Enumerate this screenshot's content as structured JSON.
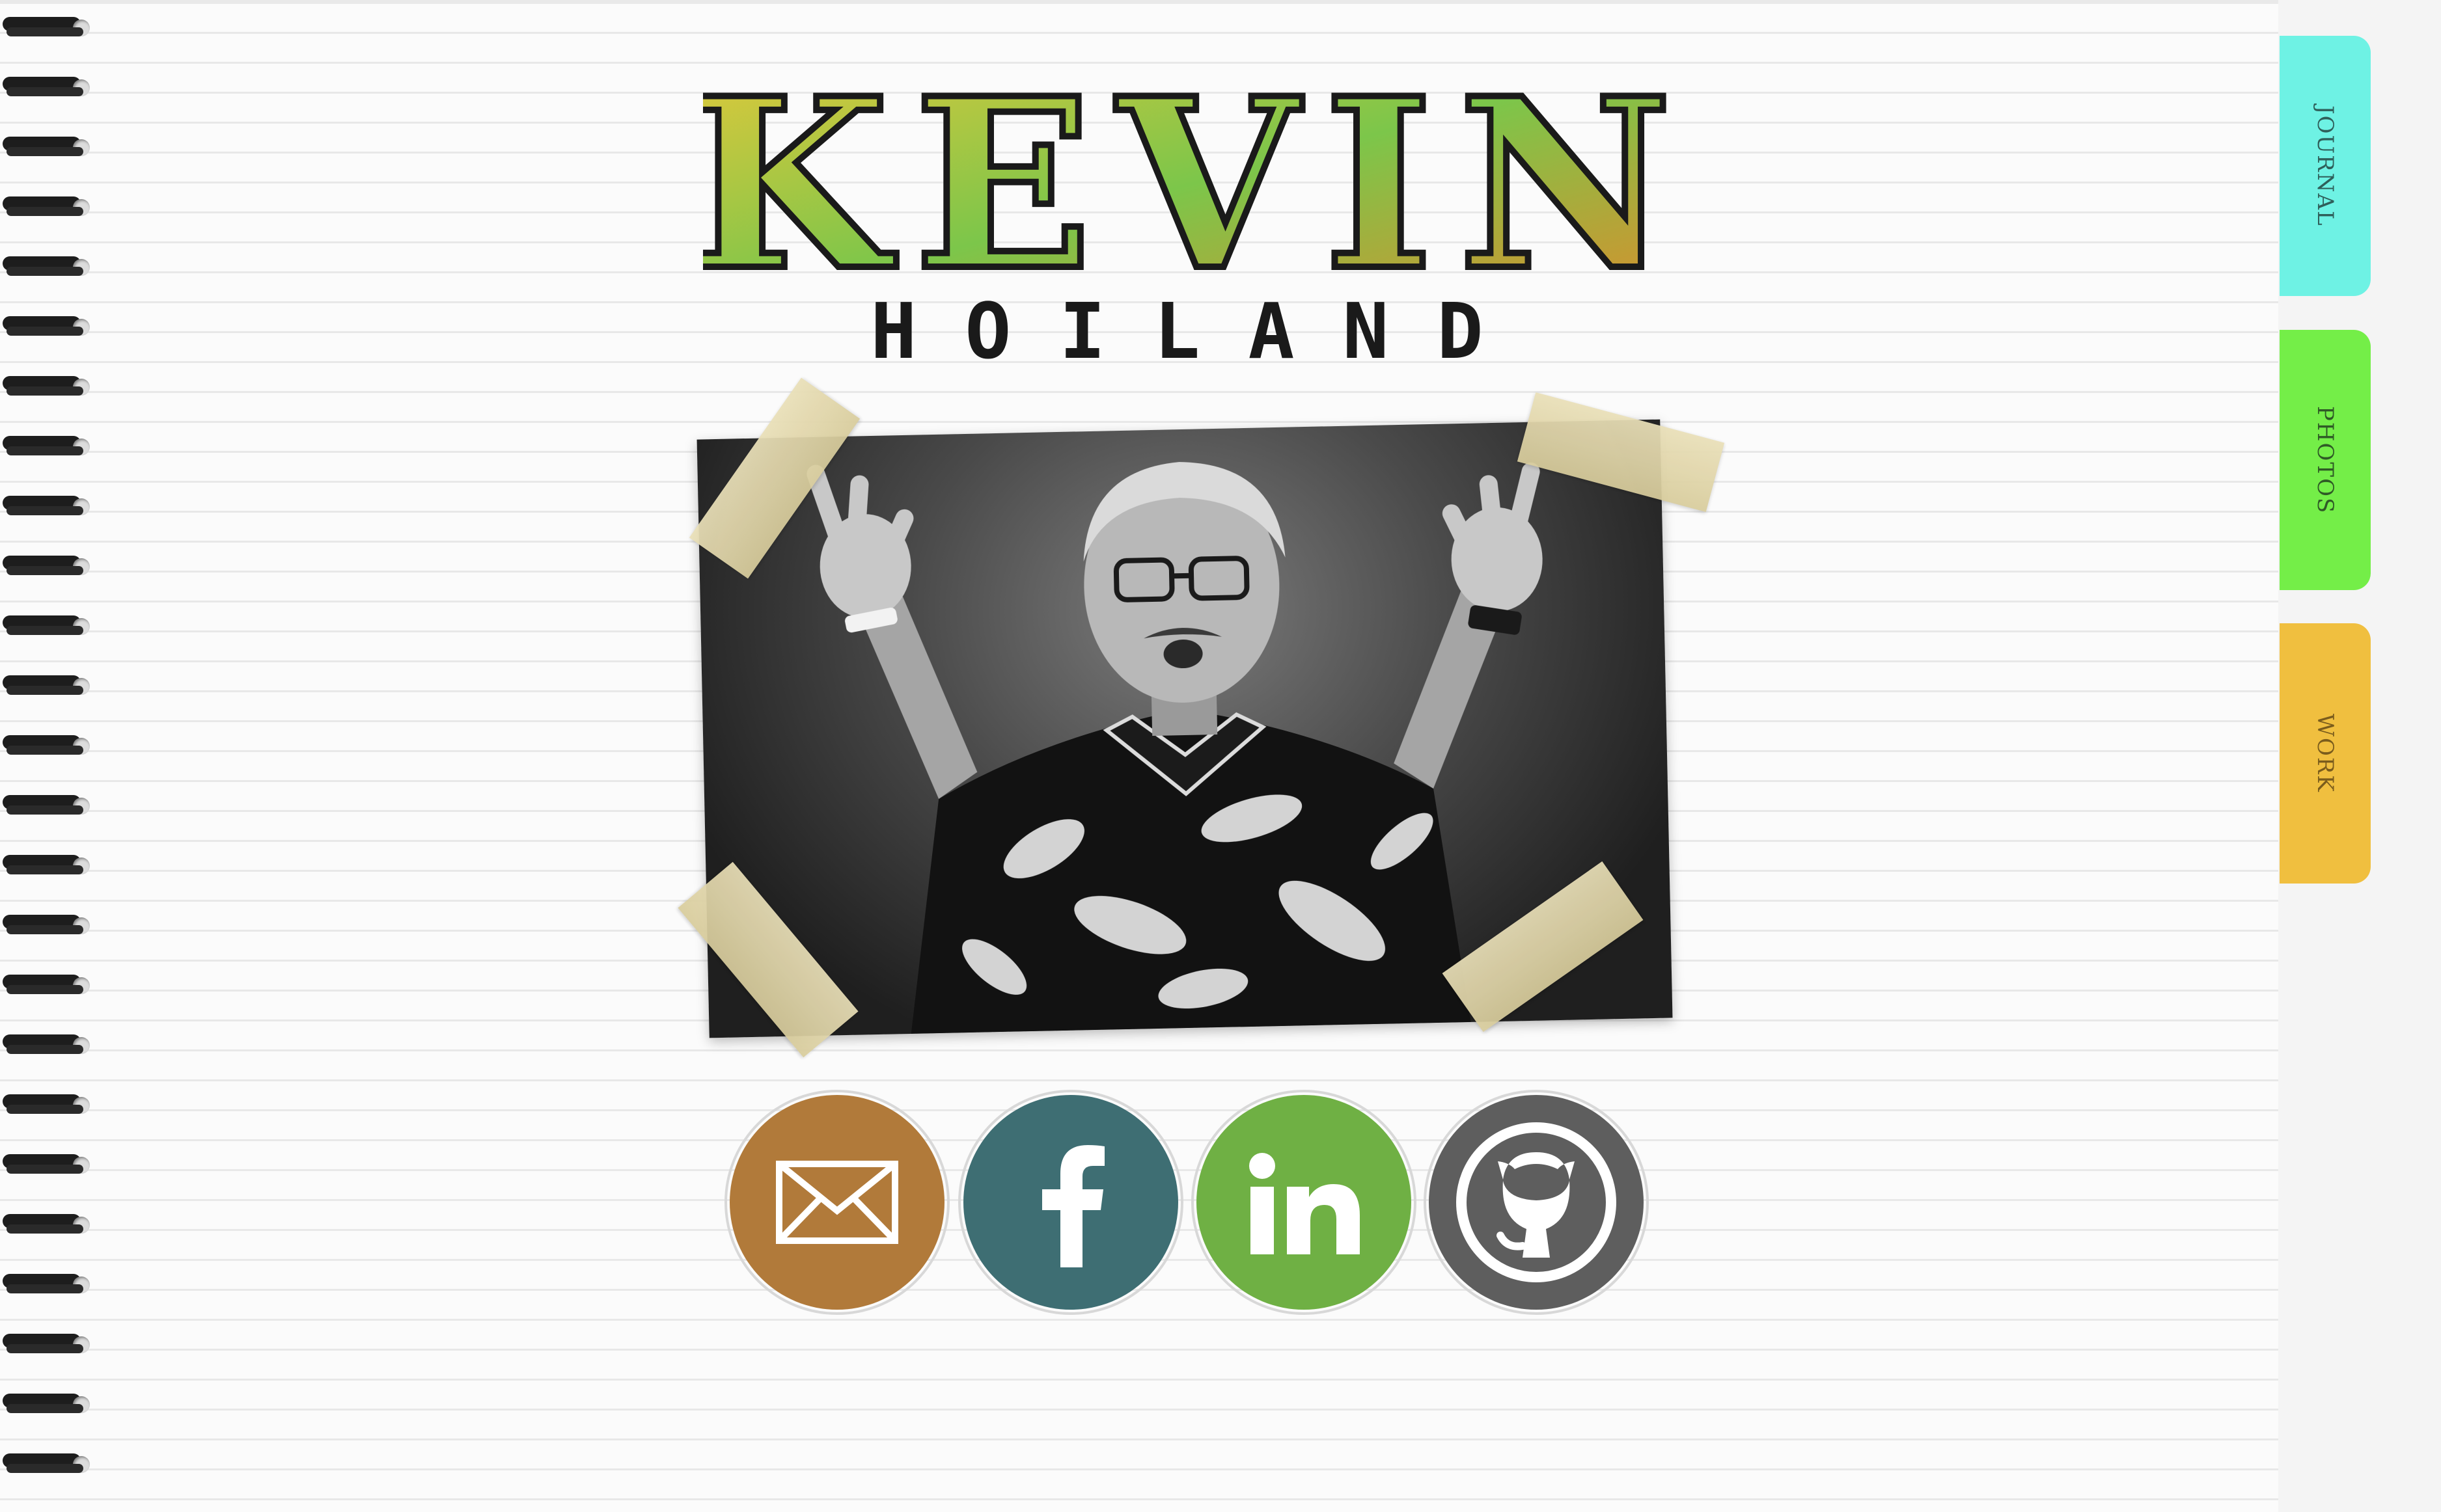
{
  "brand": {
    "first_name": "KEVIN",
    "last_name": "HOILAND"
  },
  "tabs": [
    {
      "label": "JOURNAL",
      "color": "#6ef2e4"
    },
    {
      "label": "PHOTOS",
      "color": "#74ee48"
    },
    {
      "label": "WORK",
      "color": "#f0bf3f"
    }
  ],
  "photo": {
    "subject": "portrait-photo"
  },
  "social": [
    {
      "name": "email",
      "icon": "envelope-icon",
      "color": "#b17a3a"
    },
    {
      "name": "facebook",
      "icon": "facebook-icon",
      "color": "#3e6e73"
    },
    {
      "name": "linkedin",
      "icon": "linkedin-icon",
      "color": "#6fb044"
    },
    {
      "name": "github",
      "icon": "github-icon",
      "color": "#5e5e5e"
    }
  ],
  "colors": {
    "paper": "#fbfbfb",
    "rule_line": "#e8e8e8",
    "spiral": "#1d1d1d"
  }
}
